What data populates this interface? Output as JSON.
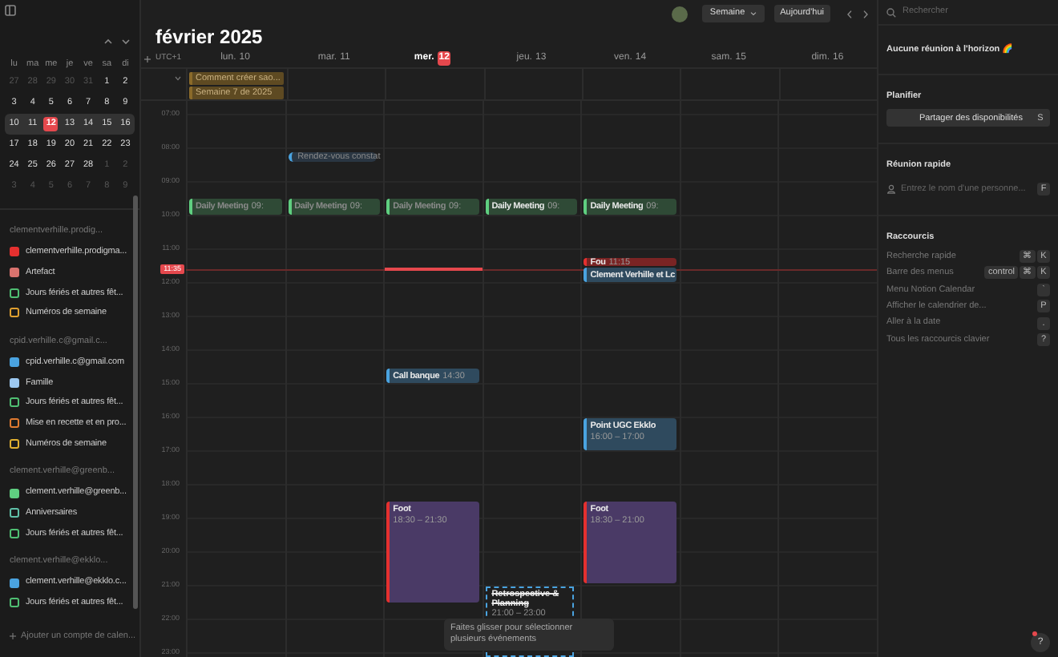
{
  "sidebar": {
    "mini_calendar": {
      "weekdays": [
        "lu",
        "ma",
        "me",
        "je",
        "ve",
        "sa",
        "di"
      ],
      "weeks": [
        {
          "selected": false,
          "days": [
            {
              "label": "27",
              "outside": true,
              "today": false
            },
            {
              "label": "28",
              "outside": true,
              "today": false
            },
            {
              "label": "29",
              "outside": true,
              "today": false
            },
            {
              "label": "30",
              "outside": true,
              "today": false
            },
            {
              "label": "31",
              "outside": true,
              "today": false
            },
            {
              "label": "1",
              "outside": false,
              "today": false
            },
            {
              "label": "2",
              "outside": false,
              "today": false
            }
          ]
        },
        {
          "selected": false,
          "days": [
            {
              "label": "3",
              "outside": false,
              "today": false
            },
            {
              "label": "4",
              "outside": false,
              "today": false
            },
            {
              "label": "5",
              "outside": false,
              "today": false
            },
            {
              "label": "6",
              "outside": false,
              "today": false
            },
            {
              "label": "7",
              "outside": false,
              "today": false
            },
            {
              "label": "8",
              "outside": false,
              "today": false
            },
            {
              "label": "9",
              "outside": false,
              "today": false
            }
          ]
        },
        {
          "selected": true,
          "days": [
            {
              "label": "10",
              "outside": false,
              "today": false
            },
            {
              "label": "11",
              "outside": false,
              "today": false
            },
            {
              "label": "12",
              "outside": false,
              "today": true
            },
            {
              "label": "13",
              "outside": false,
              "today": false
            },
            {
              "label": "14",
              "outside": false,
              "today": false
            },
            {
              "label": "15",
              "outside": false,
              "today": false
            },
            {
              "label": "16",
              "outside": false,
              "today": false
            }
          ]
        },
        {
          "selected": false,
          "days": [
            {
              "label": "17",
              "outside": false,
              "today": false
            },
            {
              "label": "18",
              "outside": false,
              "today": false
            },
            {
              "label": "19",
              "outside": false,
              "today": false
            },
            {
              "label": "20",
              "outside": false,
              "today": false
            },
            {
              "label": "21",
              "outside": false,
              "today": false
            },
            {
              "label": "22",
              "outside": false,
              "today": false
            },
            {
              "label": "23",
              "outside": false,
              "today": false
            }
          ]
        },
        {
          "selected": false,
          "days": [
            {
              "label": "24",
              "outside": false,
              "today": false
            },
            {
              "label": "25",
              "outside": false,
              "today": false
            },
            {
              "label": "26",
              "outside": false,
              "today": false
            },
            {
              "label": "27",
              "outside": false,
              "today": false
            },
            {
              "label": "28",
              "outside": false,
              "today": false
            },
            {
              "label": "1",
              "outside": true,
              "today": false
            },
            {
              "label": "2",
              "outside": true,
              "today": false
            }
          ]
        },
        {
          "selected": false,
          "days": [
            {
              "label": "3",
              "outside": true,
              "today": false
            },
            {
              "label": "4",
              "outside": true,
              "today": false
            },
            {
              "label": "5",
              "outside": true,
              "today": false
            },
            {
              "label": "6",
              "outside": true,
              "today": false
            },
            {
              "label": "7",
              "outside": true,
              "today": false
            },
            {
              "label": "8",
              "outside": true,
              "today": false
            },
            {
              "label": "9",
              "outside": true,
              "today": false
            }
          ]
        }
      ]
    },
    "accounts": [
      {
        "name": "clementverhille.prodig...",
        "calendars": [
          {
            "name": "clementverhille.prodigma...",
            "color": "#e5302f",
            "checked": true
          },
          {
            "name": "Artefact",
            "color": "#d9736e",
            "checked": true
          },
          {
            "name": "Jours fériés et autres fêt...",
            "color": "#4fbf72",
            "checked": false
          },
          {
            "name": "Numéros de semaine",
            "color": "#e0a030",
            "checked": false
          }
        ]
      },
      {
        "name": "cpid.verhille.c@gmail.c...",
        "calendars": [
          {
            "name": "cpid.verhille.c@gmail.com",
            "color": "#4aa3e0",
            "checked": true
          },
          {
            "name": "Famille",
            "color": "#9cc8f0",
            "checked": true
          },
          {
            "name": "Jours fériés et autres fêt...",
            "color": "#4fbf72",
            "checked": false
          },
          {
            "name": "Mise en recette et en pro...",
            "color": "#e07a30",
            "checked": false
          },
          {
            "name": "Numéros de semaine",
            "color": "#e0b030",
            "checked": false
          }
        ]
      },
      {
        "name": "clement.verhille@greenb...",
        "calendars": [
          {
            "name": "clement.verhille@greenb...",
            "color": "#5fcf80",
            "checked": true
          },
          {
            "name": "Anniversaires",
            "color": "#5fc0a8",
            "checked": false
          },
          {
            "name": "Jours fériés et autres fêt...",
            "color": "#4fbf72",
            "checked": false
          }
        ]
      },
      {
        "name": "clement.verhille@ekklo...",
        "calendars": [
          {
            "name": "clement.verhille@ekklo.c...",
            "color": "#4aa3e0",
            "checked": true
          },
          {
            "name": "Jours fériés et autres fêt...",
            "color": "#4fbf72",
            "checked": false
          }
        ]
      }
    ],
    "add_account": "Ajouter un compte de calen..."
  },
  "header": {
    "title": "février 2025",
    "view_button": "Semaine",
    "today_button": "Aujourd'hui"
  },
  "timezone": "UTC+1",
  "days": [
    {
      "weekday": "lun.",
      "date": "10",
      "today": false,
      "all_day": [
        "Comment créer sao...",
        "Semaine 7 de 2025"
      ],
      "events": [
        {
          "kind": "block",
          "title": "Daily Meeting",
          "time": "09:",
          "color": "#5fcf80",
          "past": true
        }
      ]
    },
    {
      "weekday": "mar.",
      "date": "11",
      "today": false,
      "events": [
        {
          "kind": "pill",
          "title": "Rendez-vous constat",
          "color": "#4aa3e0",
          "past": true
        },
        {
          "kind": "block",
          "title": "Daily Meeting",
          "time": "09:",
          "color": "#5fcf80",
          "past": true
        }
      ]
    },
    {
      "weekday": "mer.",
      "date": "12",
      "today": true,
      "events": [
        {
          "kind": "block",
          "title": "Daily Meeting",
          "time": "09:",
          "color": "#5fcf80",
          "past": true
        },
        {
          "kind": "block",
          "title": "Call banque",
          "time": "14:30",
          "color": "#4aa3e0",
          "past": false
        },
        {
          "kind": "block",
          "title": "Foot",
          "time": "18:30 – 21:30",
          "color": "#e5302f",
          "past": false
        }
      ]
    },
    {
      "weekday": "jeu.",
      "date": "13",
      "today": false,
      "events": [
        {
          "kind": "block",
          "title": "Daily Meeting",
          "time": "09:",
          "color": "#5fcf80",
          "past": false
        },
        {
          "kind": "declined",
          "title": "Retrospective & Planning",
          "time": "21:00 – 23:00",
          "color": "#4aa3e0",
          "past": false
        }
      ]
    },
    {
      "weekday": "ven.",
      "date": "14",
      "today": false,
      "events": [
        {
          "kind": "block",
          "title": "Daily Meeting",
          "time": "09:",
          "color": "#5fcf80",
          "past": false
        },
        {
          "kind": "block",
          "title": "Fou",
          "time": "11:15",
          "color": "#e5302f",
          "past": false
        },
        {
          "kind": "block",
          "title": "Clement Verhille et Lc",
          "color": "#4aa3e0",
          "past": false
        },
        {
          "kind": "block",
          "title": "Point UGC Ekklo",
          "time": "16:00 – 17:00",
          "color": "#4aa3e0",
          "past": false
        },
        {
          "kind": "block",
          "title": "Foot",
          "time": "18:30 – 21:00",
          "color": "#e5302f",
          "past": false
        }
      ]
    },
    {
      "weekday": "sam.",
      "date": "15",
      "today": false
    },
    {
      "weekday": "dim.",
      "date": "16",
      "today": false
    }
  ],
  "hours": [
    "07:00",
    "08:00",
    "09:00",
    "10:00",
    "11:00",
    "12:00",
    "13:00",
    "14:00",
    "15:00",
    "16:00",
    "17:00",
    "18:00",
    "19:00",
    "20:00",
    "21:00",
    "22:00",
    "23:00"
  ],
  "now_label": "11:35",
  "tooltip": "Faites glisser pour sélectionner plusieurs événements",
  "right_panel": {
    "search": {
      "placeholder": "Rechercher"
    },
    "upcoming": "Aucune réunion à l'horizon 🌈",
    "schedule": {
      "title": "Planifier",
      "button": "Partager des disponibilités",
      "key": "S"
    },
    "quick_meeting": {
      "title": "Réunion rapide",
      "placeholder": "Entrez le nom d'une personne...",
      "key": "F"
    },
    "shortcuts": {
      "title": "Raccourcis",
      "items": [
        {
          "label": "Recherche rapide",
          "keys": [
            "⌘",
            "K"
          ]
        },
        {
          "label": "Barre des menus",
          "keys": [
            "control",
            "⌘",
            "K"
          ]
        },
        {
          "label": "Menu Notion Calendar",
          "keys": [
            "`"
          ]
        },
        {
          "label": "Afficher le calendrier de...",
          "keys": [
            "P"
          ]
        },
        {
          "label": "Aller à la date",
          "keys": [
            "."
          ]
        },
        {
          "label": "Tous les raccourcis clavier",
          "keys": [
            "?"
          ]
        }
      ]
    },
    "help_button": "?"
  }
}
